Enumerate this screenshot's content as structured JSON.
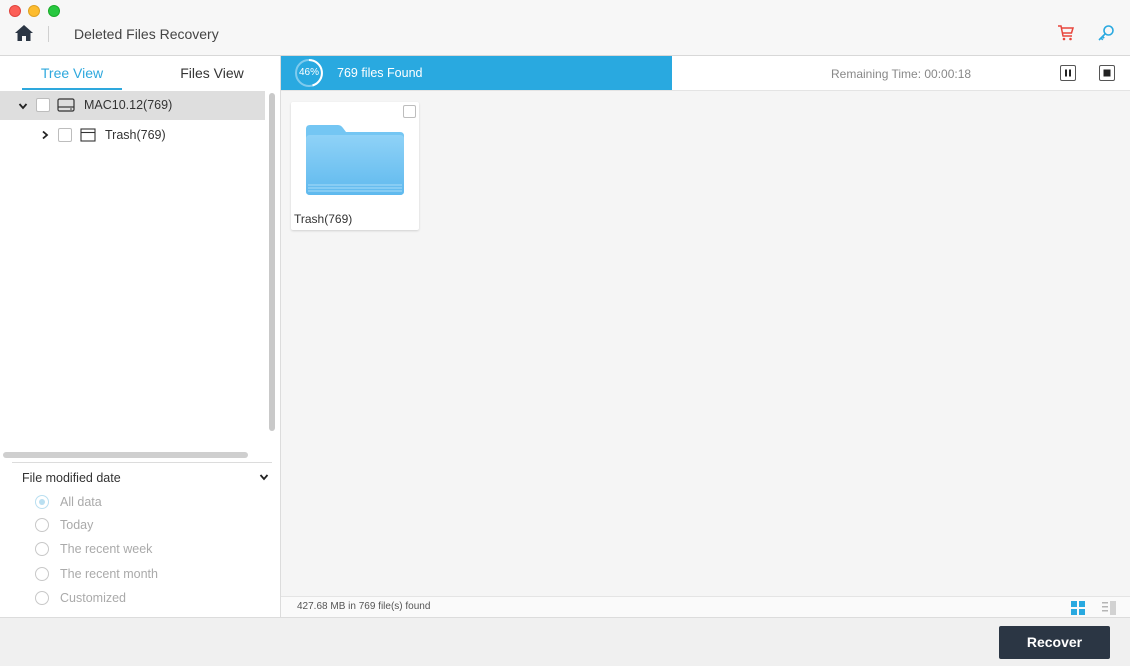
{
  "window": {
    "title": "Deleted Files Recovery"
  },
  "tabs": {
    "tree_view": "Tree View",
    "files_view": "Files View"
  },
  "tree": {
    "root": {
      "label": "MAC10.12(769)"
    },
    "child": {
      "label": "Trash(769)"
    }
  },
  "filter": {
    "title": "File modified date",
    "options": [
      "All data",
      "Today",
      "The recent week",
      "The recent month",
      "Customized"
    ],
    "selected": "All data"
  },
  "scan": {
    "percent_label": "46%",
    "percent": 46,
    "files_found": "769 files Found",
    "remaining": "Remaining Time: 00:00:18"
  },
  "results": {
    "folder_label": "Trash(769)"
  },
  "status": {
    "summary": "427.68 MB in 769 file(s) found"
  },
  "footer": {
    "recover_label": "Recover"
  },
  "colors": {
    "accent": "#29a9e0",
    "recover_bg": "#2b3644",
    "cart": "#e8453c",
    "key": "#29a9e0"
  }
}
